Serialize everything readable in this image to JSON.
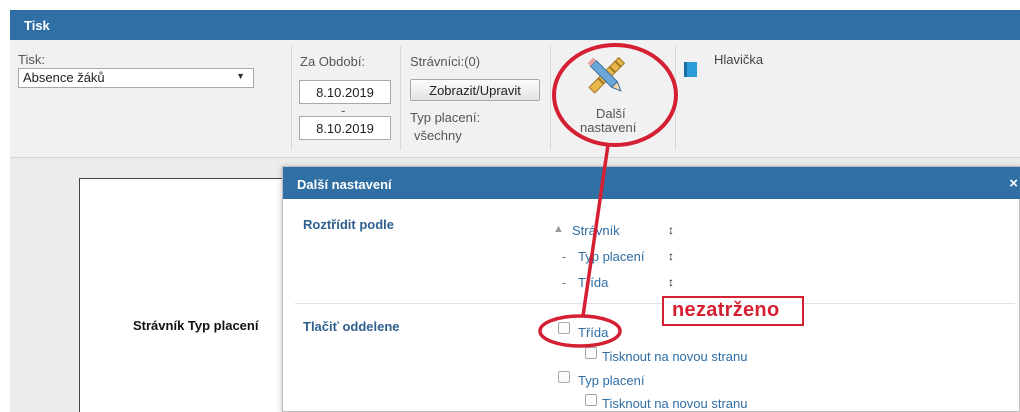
{
  "window": {
    "title": "Tisk"
  },
  "toolbar": {
    "print_label": "Tisk:",
    "print_select_value": "Absence žáků",
    "period_label": "Za Období:",
    "date_from": "8.10.2019",
    "date_separator": "-",
    "date_to": "8.10.2019",
    "diners_label": "Strávníci:(0)",
    "show_edit_button": "Zobrazit/Upravit",
    "payment_type_label": "Typ placení:",
    "payment_type_value": "všechny",
    "more_settings_line1": "Další",
    "more_settings_line2": "nastavení",
    "header_link": "Hlavička"
  },
  "preview": {
    "text": "Strávník Typ placení"
  },
  "dialog": {
    "title": "Další nastavení",
    "close": "×",
    "sort_label": "Roztřídit podle",
    "sort_items": [
      {
        "prefix": "▲",
        "label": "Strávník",
        "updown": "↕"
      },
      {
        "prefix": "-",
        "label": "Typ placení",
        "updown": "↕"
      },
      {
        "prefix": "-",
        "label": "Třída",
        "updown": "↕"
      }
    ],
    "print_separately_label": "Tlačiť oddelene",
    "options": [
      {
        "label": "Třída",
        "checked": false
      },
      {
        "label": "Tisknout na novou stranu",
        "checked": false
      },
      {
        "label": "Typ placení",
        "checked": false
      },
      {
        "label": "Tisknout na novou stranu",
        "checked": false
      }
    ]
  },
  "annotation": {
    "label": "nezatrženo",
    "color": "#d42032"
  },
  "colors": {
    "header_blue": "#2f6fa4",
    "link_blue": "#2e6da4",
    "annotation_red": "#d42032"
  }
}
